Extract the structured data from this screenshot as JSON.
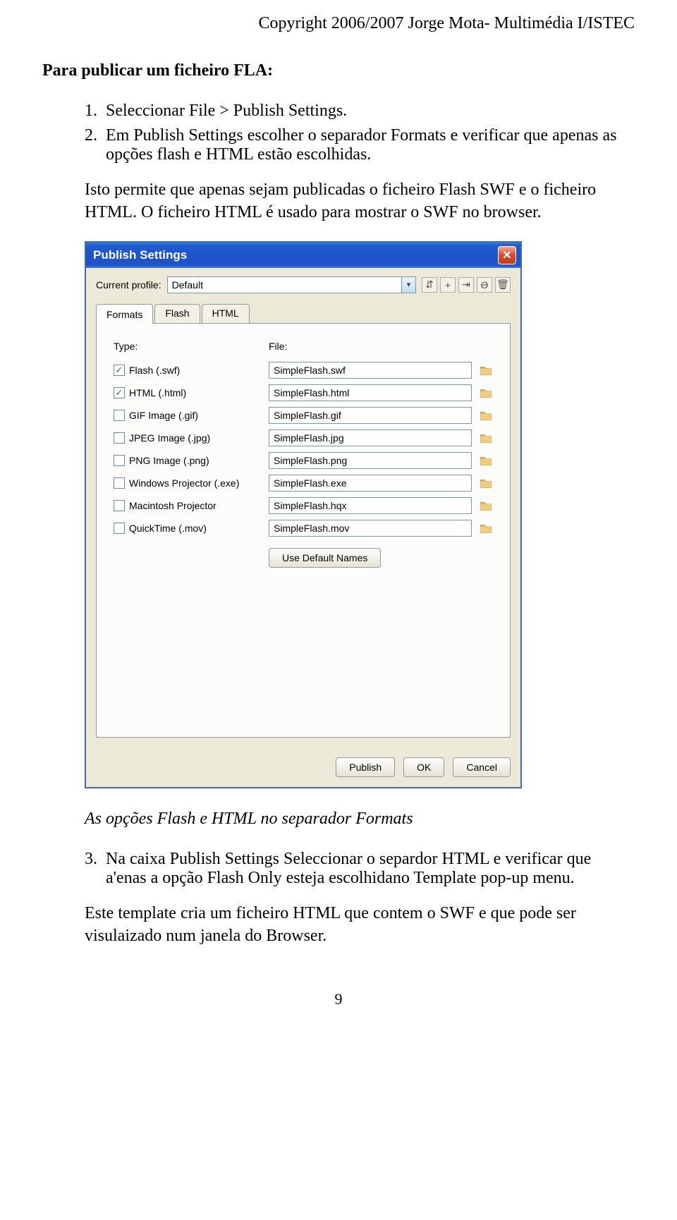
{
  "copyright": "Copyright 2006/2007 Jorge Mota- Multimédia I/ISTEC",
  "section_title": "Para publicar um ficheiro FLA:",
  "list": {
    "item1_num": "1.",
    "item1_text": "Seleccionar File > Publish Settings.",
    "item2_num": "2.",
    "item2_text": "Em Publish Settings escolher o separador Formats e verificar que apenas as opções flash e HTML estão escolhidas.",
    "item3_num": "3.",
    "item3_text": "Na caixa  Publish Settings Seleccionar o separdor  HTML e verificar que a'enas a opção Flash Only esteja escolhidano  Template pop-up menu."
  },
  "para_isto": "Isto permite que apenas sejam publicadas o ficheiro Flash SWF e o ficheiro HTML. O ficheiro HTML é usado para mostrar o SWF no browser.",
  "caption": "As opções Flash e HTML no separador Formats",
  "para_template": "Este template cria um ficheiro HTML que contem o SWF e que pode ser visulaizado num janela do Browser.",
  "page_number": "9",
  "dialog": {
    "title": "Publish Settings",
    "close_glyph": "✕",
    "profile_label": "Current profile:",
    "profile_value": "Default",
    "tool_icons": {
      "a": "⇵",
      "b": "+",
      "c": "⇥",
      "d": "ϴ",
      "e": "🗑"
    },
    "tabs": {
      "formats": "Formats",
      "flash": "Flash",
      "html": "HTML"
    },
    "headers": {
      "type": "Type:",
      "file": "File:"
    },
    "rows": [
      {
        "label": "Flash (.swf)",
        "checked": true,
        "file": "SimpleFlash.swf"
      },
      {
        "label": "HTML (.html)",
        "checked": true,
        "file": "SimpleFlash.html"
      },
      {
        "label": "GIF Image (.gif)",
        "checked": false,
        "file": "SimpleFlash.gif"
      },
      {
        "label": "JPEG Image (.jpg)",
        "checked": false,
        "file": "SimpleFlash.jpg"
      },
      {
        "label": "PNG Image (.png)",
        "checked": false,
        "file": "SimpleFlash.png"
      },
      {
        "label": "Windows Projector (.exe)",
        "checked": false,
        "file": "SimpleFlash.exe"
      },
      {
        "label": "Macintosh Projector",
        "checked": false,
        "file": "SimpleFlash.hqx"
      },
      {
        "label": "QuickTime (.mov)",
        "checked": false,
        "file": "SimpleFlash.mov"
      }
    ],
    "use_default": "Use Default Names",
    "buttons": {
      "publish": "Publish",
      "ok": "OK",
      "cancel": "Cancel"
    }
  }
}
